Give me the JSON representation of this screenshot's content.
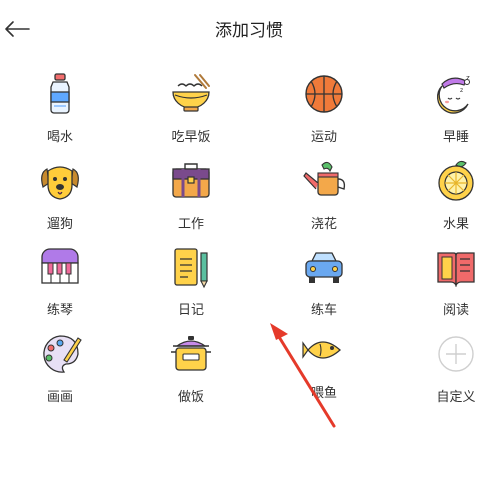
{
  "header": {
    "title": "添加习惯",
    "back_icon": "back-arrow-icon"
  },
  "habits": [
    {
      "label": "喝水",
      "icon": "water-bottle-icon"
    },
    {
      "label": "吃早饭",
      "icon": "noodle-bowl-icon"
    },
    {
      "label": "运动",
      "icon": "basketball-icon"
    },
    {
      "label": "早睡",
      "icon": "sleeping-moon-icon"
    },
    {
      "label": "遛狗",
      "icon": "dog-icon"
    },
    {
      "label": "工作",
      "icon": "briefcase-icon"
    },
    {
      "label": "浇花",
      "icon": "watering-can-icon"
    },
    {
      "label": "水果",
      "icon": "lemon-icon"
    },
    {
      "label": "练琴",
      "icon": "piano-icon"
    },
    {
      "label": "日记",
      "icon": "notebook-pencil-icon"
    },
    {
      "label": "练车",
      "icon": "car-icon"
    },
    {
      "label": "阅读",
      "icon": "open-book-icon"
    },
    {
      "label": "画画",
      "icon": "paint-palette-icon"
    },
    {
      "label": "做饭",
      "icon": "cooking-pot-icon"
    },
    {
      "label": "喂鱼",
      "icon": "fish-icon"
    },
    {
      "label": "自定义",
      "icon": "add-circle-icon"
    }
  ],
  "colors": {
    "annotation_arrow": "#e53a2a",
    "accent_yellow": "#ffd24a",
    "outline": "#333333"
  }
}
